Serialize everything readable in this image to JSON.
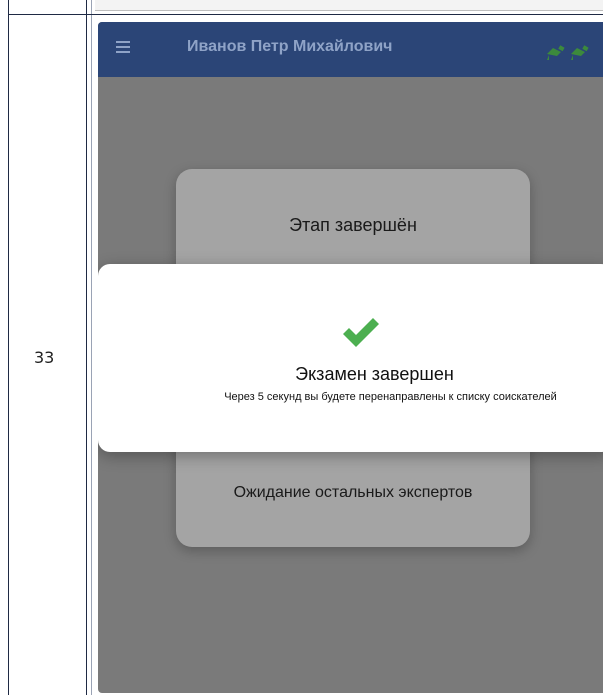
{
  "table": {
    "row_number": "33"
  },
  "app_bar": {
    "title": "Иванов Петр Михайлович",
    "menu_icon": "hamburger-menu-icon",
    "status_icons": [
      "camera-icon",
      "camera-icon"
    ],
    "color": "#2b4577"
  },
  "stage_card": {
    "title": "Этап завершён",
    "waiting_text": "Ожидание остальных экспертов"
  },
  "modal": {
    "icon": "checkmark-icon",
    "icon_color": "#4caf50",
    "title": "Экзамен завершен",
    "message": "Через 5 секунд вы будете перенаправлены к списку соискателей"
  }
}
